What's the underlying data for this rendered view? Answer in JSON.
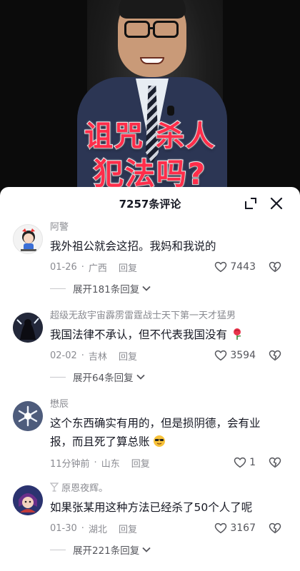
{
  "video": {
    "caption_line1": "诅咒 杀人",
    "caption_line2": "犯法吗?"
  },
  "sheet": {
    "title": "7257条评论",
    "expand_icon": "expand-icon",
    "close_icon": "close-icon"
  },
  "comments": [
    {
      "username": "阿警",
      "text": "我外祖公就会这招。我妈和我说的",
      "date": "01-26",
      "location": "广西",
      "reply_label": "回复",
      "likes": "7443",
      "expand_label": "展开181条回复",
      "avatar_icon": "cartoon-girl-avatar"
    },
    {
      "username": "超级无敌宇宙霹雳雷霆战士天下第一天才猛男",
      "text": "我国法律不承认，但不代表我国没有",
      "emoji": "rose-emoji",
      "date": "02-02",
      "location": "吉林",
      "reply_label": "回复",
      "likes": "3594",
      "expand_label": "展开64条回复",
      "avatar_icon": "dark-figure-avatar"
    },
    {
      "username": "懋辰",
      "text": "这个东西确实有用的，但是损阴德，会有业报，而且死了算总账",
      "emoji": "cool-face-emoji",
      "date": "11分钟前",
      "location": "山东",
      "reply_label": "回复",
      "likes": "1",
      "avatar_icon": "snow-flower-avatar"
    },
    {
      "username": "原恩夜辉。",
      "username_prefix_icon": "cocktail-icon",
      "text": "如果张某用这种方法已经杀了50个人了呢",
      "date": "01-30",
      "location": "湖北",
      "reply_label": "回复",
      "likes": "3167",
      "expand_label": "展开221条回复",
      "avatar_icon": "anime-character-avatar"
    }
  ],
  "colors": {
    "caption_red": "#ff2d4a",
    "text_primary": "#161823",
    "text_secondary": "#8a8b91"
  }
}
